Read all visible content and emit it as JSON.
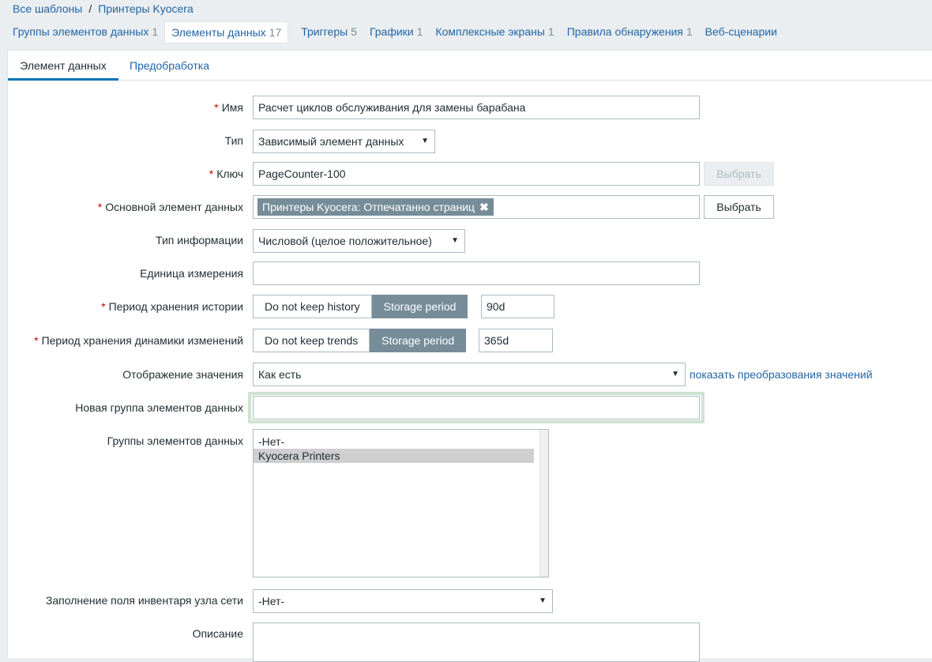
{
  "breadcrumb": {
    "all_templates": "Все шаблоны",
    "separator": "/",
    "template": "Принтеры Kyocera"
  },
  "nav": [
    {
      "label": "Группы элементов данных",
      "count": "1"
    },
    {
      "label": "Элементы данных",
      "count": "17",
      "active": true
    },
    {
      "label": "Триггеры",
      "count": "5"
    },
    {
      "label": "Графики",
      "count": "1"
    },
    {
      "label": "Комплексные экраны",
      "count": "1"
    },
    {
      "label": "Правила обнаружения",
      "count": "1"
    },
    {
      "label": "Веб-сценарии",
      "count": ""
    }
  ],
  "tabs": {
    "item": "Элемент данных",
    "preprocessing": "Предобработка"
  },
  "form": {
    "required_mark": "*",
    "name": {
      "label": "Имя",
      "value": "Расчет циклов обслуживания для замены барабана"
    },
    "type": {
      "label": "Тип",
      "value": "Зависимый элемент данных"
    },
    "key": {
      "label": "Ключ",
      "value": "PageCounter-100",
      "button": "Выбрать"
    },
    "master_item": {
      "label": "Основной элемент данных",
      "chip": "Принтеры Kyocera: Отпечатанно страниц",
      "chip_remove": "✖",
      "button": "Выбрать"
    },
    "info_type": {
      "label": "Тип информации",
      "value": "Числовой (целое положительное)"
    },
    "units": {
      "label": "Единица измерения",
      "value": ""
    },
    "history": {
      "label": "Период хранения истории",
      "opt_off": "Do not keep history",
      "opt_on": "Storage period",
      "value": "90d"
    },
    "trends": {
      "label": "Период хранения динамики изменений",
      "opt_off": "Do not keep trends",
      "opt_on": "Storage period",
      "value": "365d"
    },
    "valuemap": {
      "label": "Отображение значения",
      "value": "Как есть",
      "link": "показать преобразования значений"
    },
    "new_group": {
      "label": "Новая группа элементов данных",
      "value": ""
    },
    "groups": {
      "label": "Группы элементов данных",
      "options": [
        "-Нет-",
        "Kyocera Printers"
      ]
    },
    "inventory": {
      "label": "Заполнение поля инвентаря узла сети",
      "value": "-Нет-"
    },
    "description": {
      "label": "Описание",
      "value": ""
    }
  },
  "icons": {
    "dropdown": "▼"
  },
  "colors": {
    "accent": "#0275b8",
    "link": "#1f65a6",
    "segment_on": "#768d99",
    "required": "#d40000"
  }
}
